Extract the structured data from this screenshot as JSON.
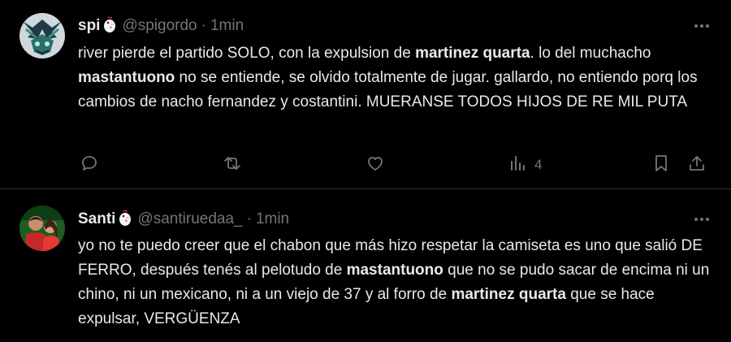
{
  "tweets": [
    {
      "name": "spi",
      "handle": "@spigordo",
      "separator": "·",
      "time": "1min",
      "segments": [
        {
          "t": "river pierde el partido SOLO, con la expulsion de "
        },
        {
          "t": "martinez quarta",
          "b": true
        },
        {
          "t": ". lo del muchacho "
        },
        {
          "t": "mastantuono",
          "b": true
        },
        {
          "t": " no se entiende, se olvido totalmente de jugar. gallardo, no entiendo porq los cambios de nacho fernandez y costantini. MUERANSE TODOS HIJOS DE RE MIL PUTA"
        }
      ],
      "views": "4"
    },
    {
      "name": "Santi",
      "handle": "@santiruedaa_",
      "separator": "·",
      "time": "1min",
      "segments": [
        {
          "t": "yo no te puedo creer que el chabon que más hizo respetar la camiseta es uno que salió DE FERRO, después tenés al pelotudo de "
        },
        {
          "t": "mastantuono",
          "b": true
        },
        {
          "t": " que no se pudo sacar de encima ni un chino, ni un mexicano, ni a un viejo de 37 y al forro de "
        },
        {
          "t": "martinez quarta",
          "b": true
        },
        {
          "t": " que se hace expulsar, VERGÜENZA"
        }
      ]
    }
  ],
  "icons": {
    "emoji": "chicken-emoji",
    "more": "more-horizontal-icon",
    "actions": [
      "reply-icon",
      "retweet-icon",
      "like-icon",
      "views-icon",
      "bookmark-icon",
      "share-icon"
    ]
  },
  "colors": {
    "background": "#000000",
    "text": "#e7e9ea",
    "muted": "#71767b",
    "divider": "#2f3336"
  }
}
